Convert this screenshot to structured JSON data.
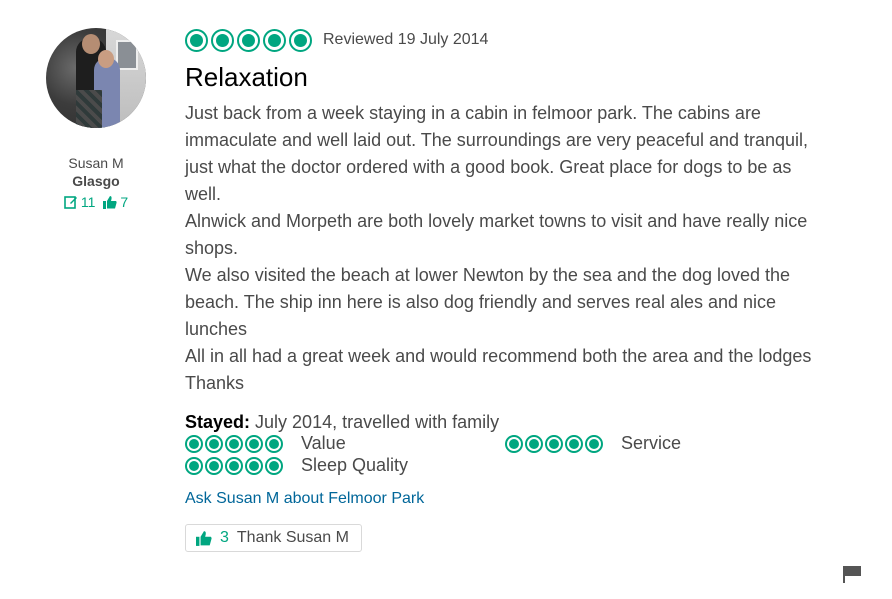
{
  "member": {
    "name": "Susan M",
    "location": "Glasgo",
    "reviews_count": "11",
    "helpful_votes": "7"
  },
  "review": {
    "rating": 5,
    "date": "Reviewed 19 July 2014",
    "title": "Relaxation",
    "paragraphs": [
      "Just back from a week staying in a cabin in felmoor park. The cabins are immaculate and well laid out. The surroundings are very peaceful and tranquil, just what the doctor ordered with a good book. Great place for dogs to be as well.",
      "Alnwick and Morpeth are both lovely market towns to visit and have really nice shops.",
      "We also visited the beach at lower Newton by the sea and the dog loved the beach. The ship inn here is also dog friendly and serves real ales and nice lunches",
      "All in all had a great week and would recommend both the area and the lodges",
      "Thanks"
    ],
    "stayed_label": "Stayed:",
    "stayed_value": " July 2014, travelled with family",
    "subratings": [
      {
        "label": "Value",
        "rating": 5
      },
      {
        "label": "Service",
        "rating": 5
      },
      {
        "label": "Sleep Quality",
        "rating": 5
      }
    ],
    "ask_link": "Ask Susan M about Felmoor Park",
    "thank_count": "3",
    "thank_label": "Thank Susan M"
  },
  "colors": {
    "accent": "#00a680",
    "link": "#006699",
    "text": "#4a4a4a"
  },
  "icons": {
    "review_count": "edit-icon",
    "helpful": "thumbs-up-icon",
    "report": "flag-icon"
  }
}
